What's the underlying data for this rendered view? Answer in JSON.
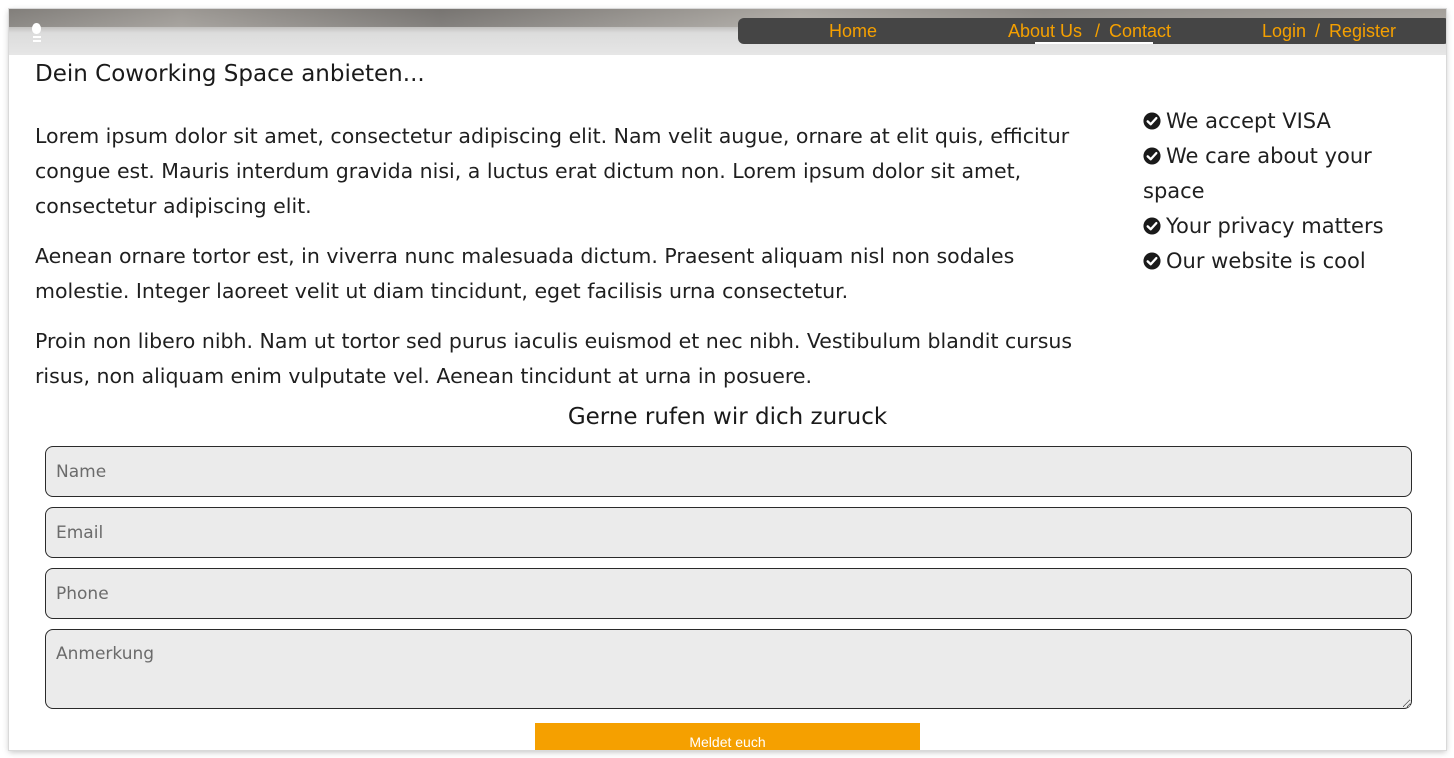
{
  "nav": {
    "home": "Home",
    "about": "About Us",
    "separator": "/",
    "contact": "Contact",
    "login": "Login",
    "register": "Register"
  },
  "main": {
    "title": "Dein Coworking Space anbieten...",
    "paragraphs": [
      "Lorem ipsum dolor sit amet, consectetur adipiscing elit. Nam velit augue, ornare at elit quis, efficitur congue est. Mauris interdum gravida nisi, a luctus erat dictum non. Lorem ipsum dolor sit amet, consectetur adipiscing elit.",
      "Aenean ornare tortor est, in viverra nunc malesuada dictum. Praesent aliquam nisl non sodales molestie. Integer laoreet velit ut diam tincidunt, eget facilisis urna consectetur.",
      "Proin non libero nibh. Nam ut tortor sed purus iaculis euismod et nec nibh. Vestibulum blandit cursus risus, non aliquam enim vulputate vel. Aenean tincidunt at urna in posuere."
    ]
  },
  "features": [
    "We accept VISA",
    "We care about your space",
    "Your privacy matters",
    "Our website is cool"
  ],
  "form": {
    "title": "Gerne rufen wir dich zuruck",
    "name_placeholder": "Name",
    "email_placeholder": "Email",
    "phone_placeholder": "Phone",
    "note_placeholder": "Anmerkung",
    "submit_label": "Meldet euch"
  },
  "colors": {
    "accent": "#f5a000",
    "navbar": "#454545",
    "field_background": "#ebebeb"
  },
  "icons": {
    "logo": "lightbulb-icon",
    "feature": "check-circle-icon"
  }
}
